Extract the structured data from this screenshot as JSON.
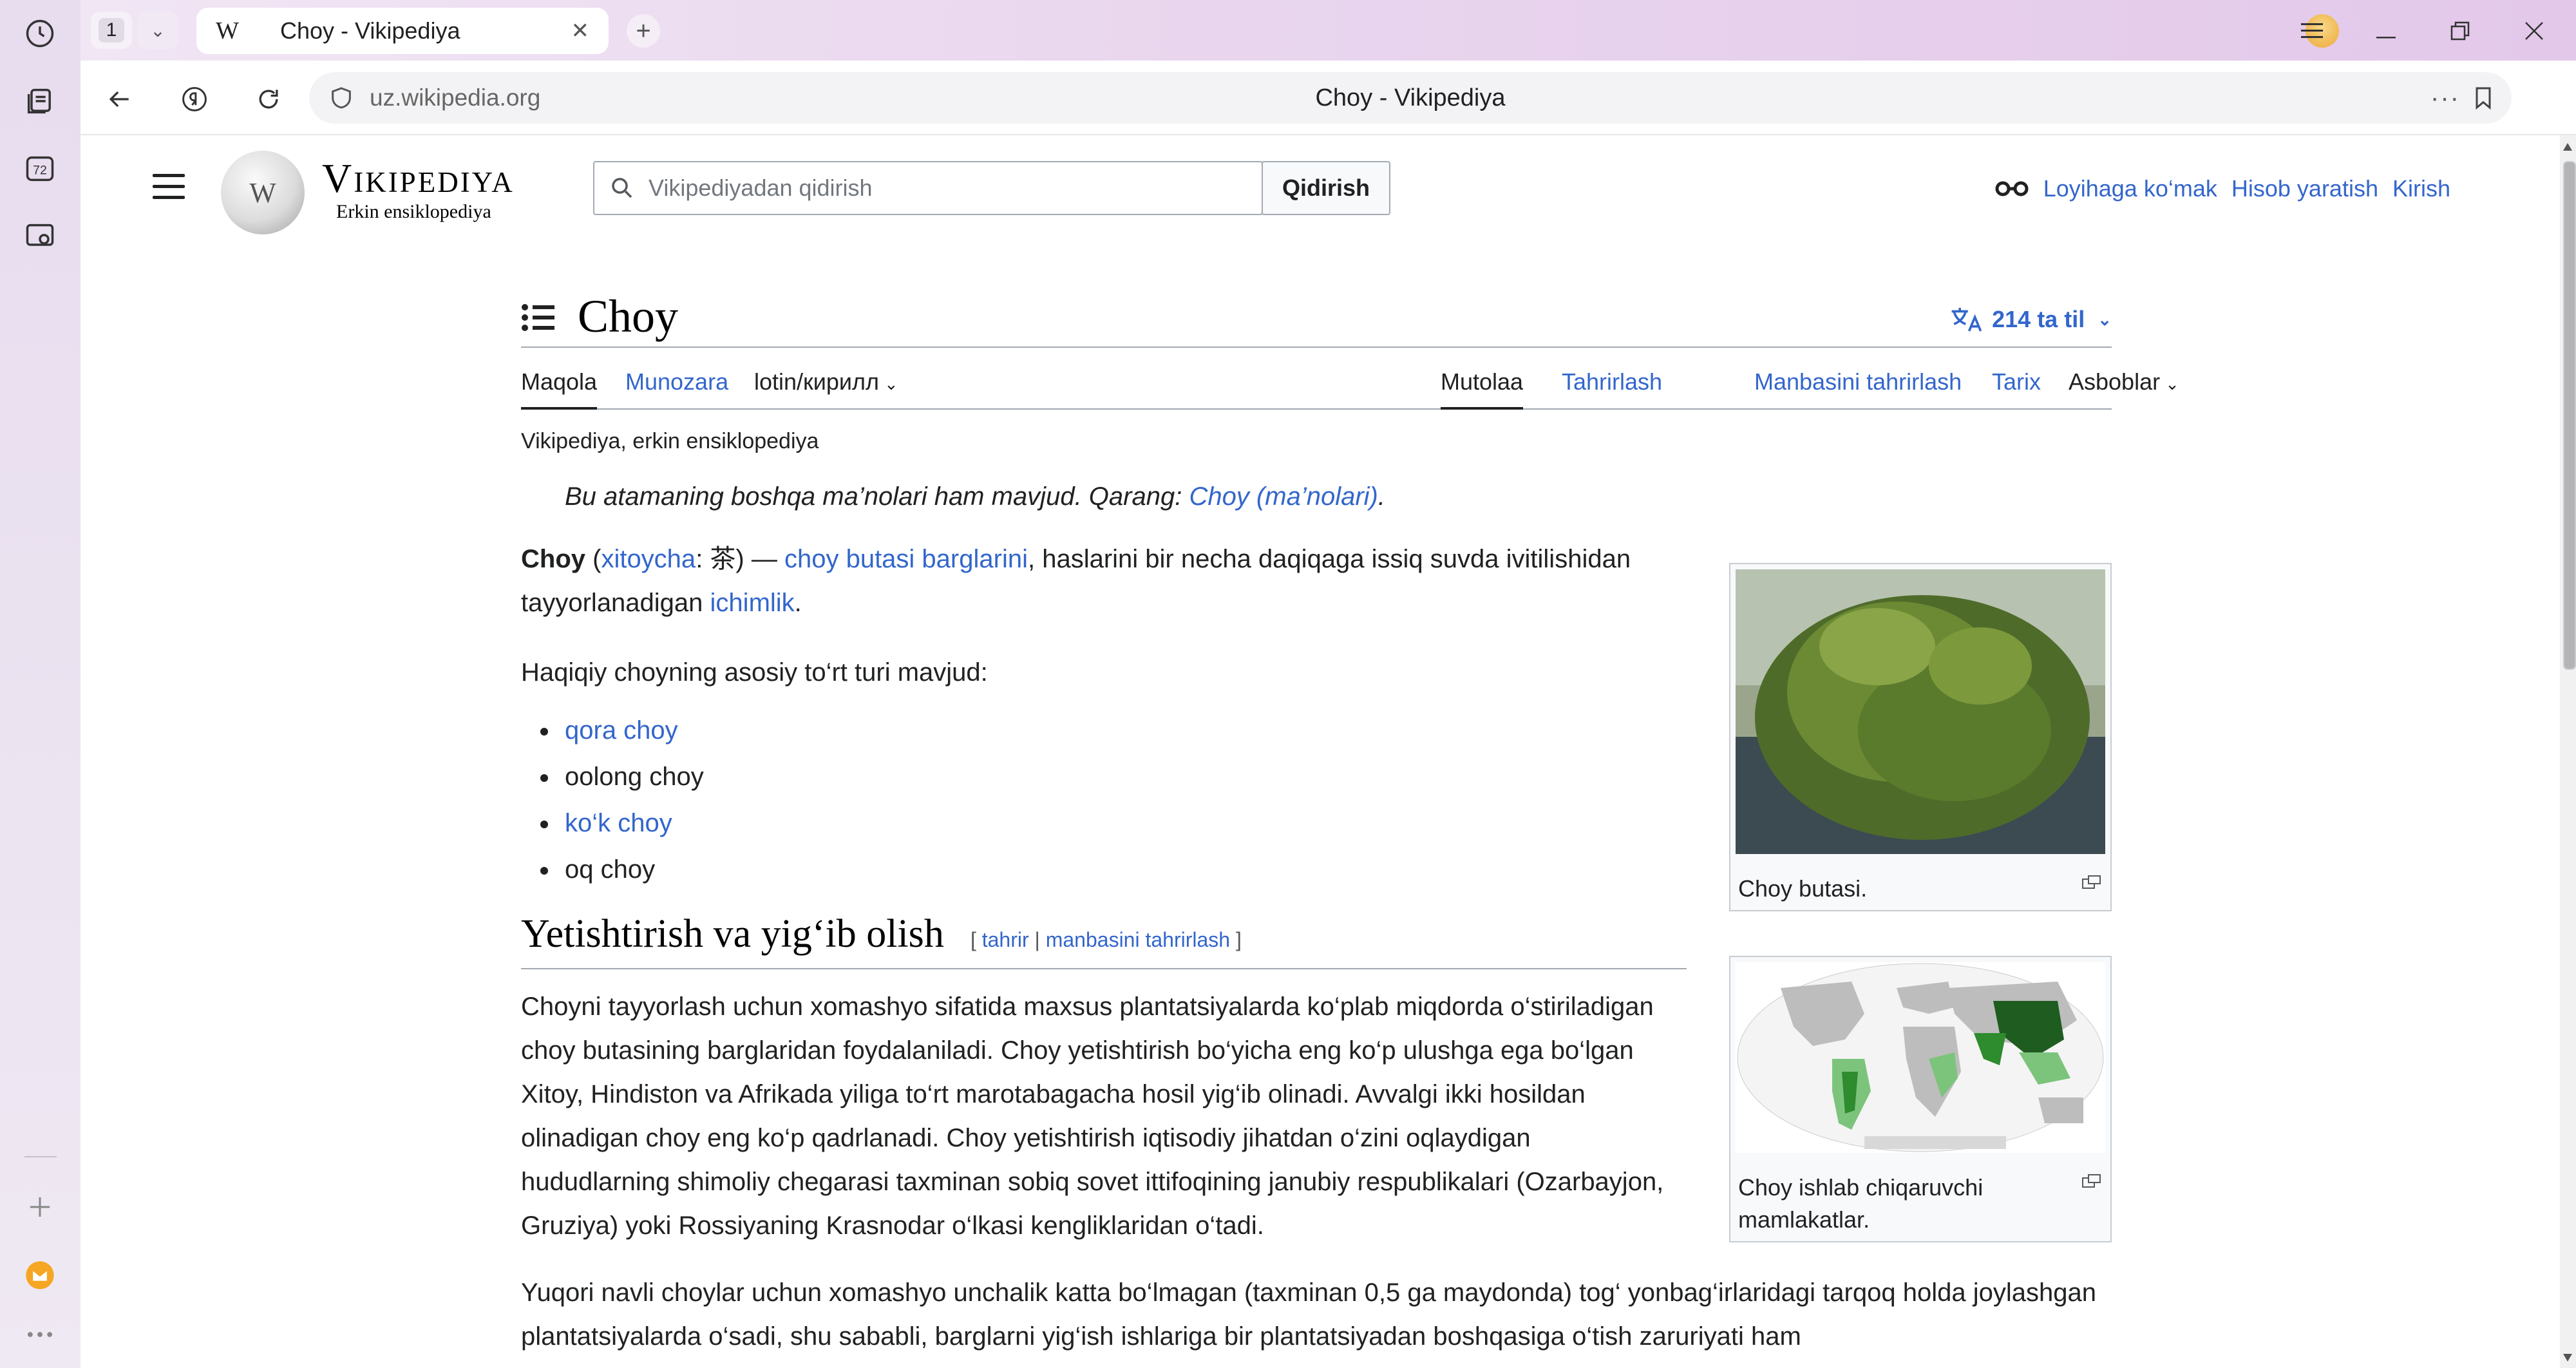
{
  "browser": {
    "tab_count": "1",
    "active_tab": {
      "favicon": "W",
      "title": "Choy - Vikipediya"
    },
    "address": {
      "url": "uz.wikipedia.org",
      "page_title": "Choy - Vikipediya"
    },
    "rail_badge": "72",
    "icons": [
      "history-icon",
      "collections-icon",
      "tabs-counter-icon",
      "screenshot-icon",
      "add-icon",
      "mail-icon",
      "more-icon"
    ]
  },
  "site": {
    "wordmark": "Vikipediya",
    "tagline": "Erkin ensiklopediya",
    "search_placeholder": "Vikipediyadan qidirish",
    "search_button": "Qidirish",
    "usernav": {
      "donate": "Loyihaga ko‘mak",
      "create_account": "Hisob yaratish",
      "login": "Kirish"
    }
  },
  "article": {
    "title": "Choy",
    "languages": "214 ta til",
    "tabs": {
      "article": "Maqola",
      "talk": "Munozara",
      "variant": "lotin/кирилл",
      "read": "Mutolaa",
      "edit": "Tahrirlash",
      "edit_source": "Manbasini tahrirlash",
      "history": "Tarix",
      "tools": "Asboblar"
    },
    "site_sub": "Vikipediya, erkin ensiklopediya",
    "hatnote_text": "Bu atamaning boshqa ma’nolari ham mavjud. Qarang: ",
    "hatnote_link": "Choy (ma’nolari)",
    "hatnote_end": ".",
    "lead": {
      "bold": "Choy",
      "p1": " (",
      "link1": "xitoycha",
      "p2": ": 茶) — ",
      "link2": "choy butasi barglarini",
      "p3": ", haslarini bir necha daqiqaga issiq suvda ivitilishidan tayyorlanadigan ",
      "link3": "ichimlik",
      "p4": "."
    },
    "types_intro": "Haqiqiy choyning asosiy to‘rt turi mavjud:",
    "types": [
      {
        "label": "qora choy",
        "link": true
      },
      {
        "label": "oolong choy",
        "link": false
      },
      {
        "label": "ko‘k choy",
        "link": true
      },
      {
        "label": "oq choy",
        "link": false
      }
    ],
    "section1": {
      "heading": "Yetishtirish va yig‘ib olish",
      "edit_open": "[ ",
      "edit": "tahrir",
      "sep": " | ",
      "edit_source": "manbasini tahrirlash",
      "edit_close": " ]",
      "para1": "Choyni tayyorlash uchun xomashyo sifatida maxsus plantatsiyalarda ko‘plab miqdorda o‘stiriladigan choy butasining barglaridan foydalaniladi. Choy yetishtirish bo‘yicha eng ko‘p ulushga ega bo‘lgan Xitoy, Hindiston va Afrikada yiliga to‘rt marotabagacha hosil yig‘ib olinadi. Avvalgi ikki hosildan olinadigan choy eng ko‘p qadrlanadi. Choy yetishtirish iqtisodiy jihatdan o‘zini oqlaydigan hududlarning shimoliy chegarasi taxminan sobiq sovet ittifoqining janubiy respublikalari (Ozarbayjon, Gruziya) yoki Rossiyaning Krasnodar o‘lkasi kengliklaridan o‘tadi.",
      "para2": "Yuqori navli choylar uchun xomashyo unchalik katta bo‘lmagan (taxminan 0,5 ga maydonda) tog‘ yonbag‘irlaridagi tarqoq holda joylashgan plantatsiyalarda o‘sadi, shu sababli, barglarni yig‘ish ishlariga bir plantatsiyadan boshqasiga o‘tish zaruriyati ham"
    },
    "figures": [
      {
        "caption": "Choy butasi."
      },
      {
        "caption": "Choy ishlab chiqaruvchi mamlakatlar."
      }
    ],
    "colors": {
      "link": "#3366cc",
      "text": "#202122",
      "border": "#a2a9b1"
    }
  }
}
